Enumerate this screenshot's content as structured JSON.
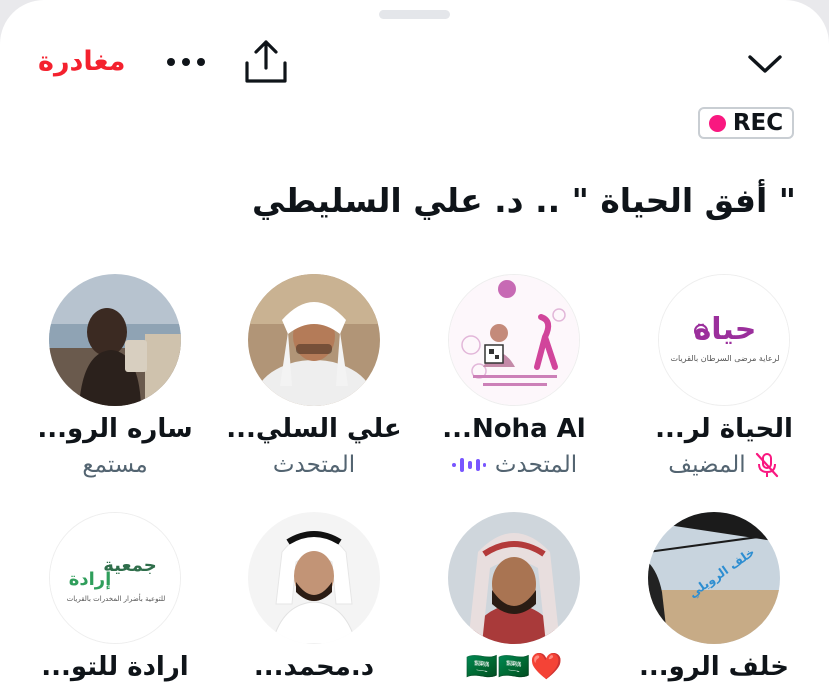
{
  "header": {
    "leave_label": "مغادرة",
    "more_icon": "more-horizontal-icon",
    "share_icon": "share-icon",
    "collapse_icon": "chevron-down-icon"
  },
  "recording": {
    "label": "REC",
    "dot_color": "#f91880"
  },
  "space": {
    "title": "\" أفق الحياة \" .. د. علي السليطي"
  },
  "colors": {
    "leave": "#f4212e",
    "muted": "#f91880",
    "speaking_bars": "#7856ff",
    "name": "#0f1419",
    "role": "#536471"
  },
  "participants": [
    {
      "name": "الحياة لر...",
      "role": "المضيف",
      "status_icon": "mic-muted-icon"
    },
    {
      "name": "Noha Al...",
      "role": "المتحدث",
      "status_icon": "speaking-bars-icon"
    },
    {
      "name": "علي السلي...",
      "role": "المتحدث"
    },
    {
      "name": "ساره الرو...",
      "role": "مستمع"
    },
    {
      "name": "خلف الرو..."
    },
    {
      "name": "❤️🇸🇦🇸🇦"
    },
    {
      "name": "د.محمد..."
    },
    {
      "name": "ارادة للتو..."
    }
  ],
  "avatars": {
    "p0": {
      "logo_text": "حياة",
      "caption": "لرعاية مرضى السرطان بالقريات"
    },
    "p4": {
      "overlay_text": "خلف الرويلي"
    },
    "p7": {
      "line1": "جمعية",
      "line2": "إرادة",
      "caption": "للتوعية بأضرار المخدرات بالقريات"
    }
  }
}
